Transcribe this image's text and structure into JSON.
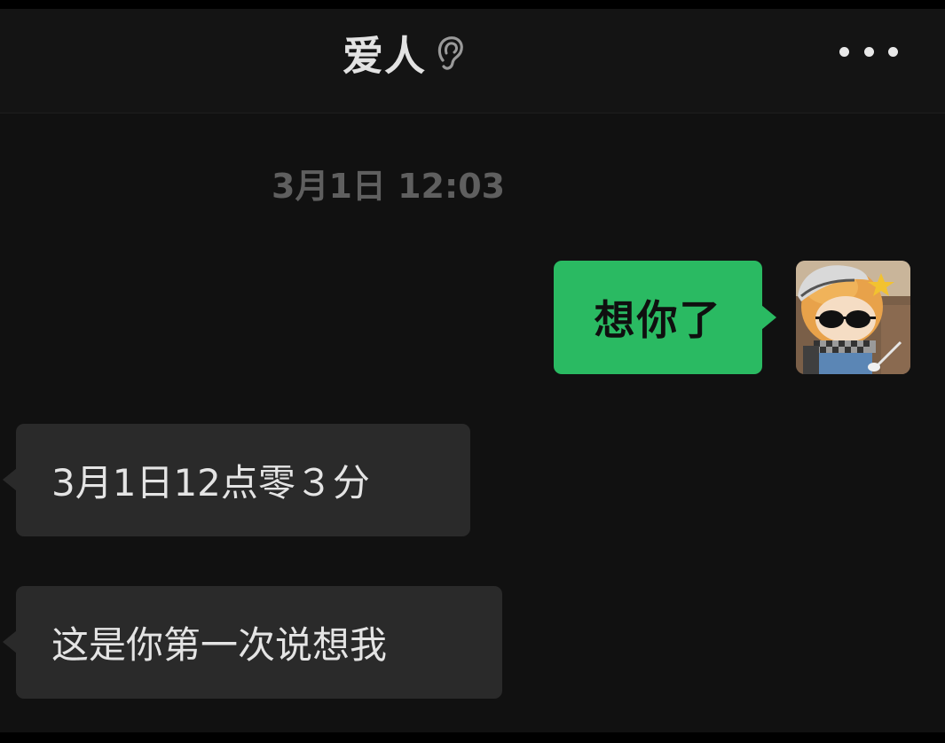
{
  "header": {
    "title": "爱人",
    "title_icon": "ear-icon",
    "menu_icon": "more-dots-icon"
  },
  "timestamp": "3月1日 12:03",
  "messages": [
    {
      "direction": "outgoing",
      "text": "想你了",
      "avatar": "plush-doll-avatar"
    },
    {
      "direction": "incoming",
      "text": "3月1日12点零３分"
    },
    {
      "direction": "incoming",
      "text": "这是你第一次说想我"
    }
  ],
  "colors": {
    "background": "#111111",
    "outgoing_bubble": "#2aba62",
    "incoming_bubble": "#2a2a2a",
    "timestamp_text": "#5f5f5f"
  }
}
